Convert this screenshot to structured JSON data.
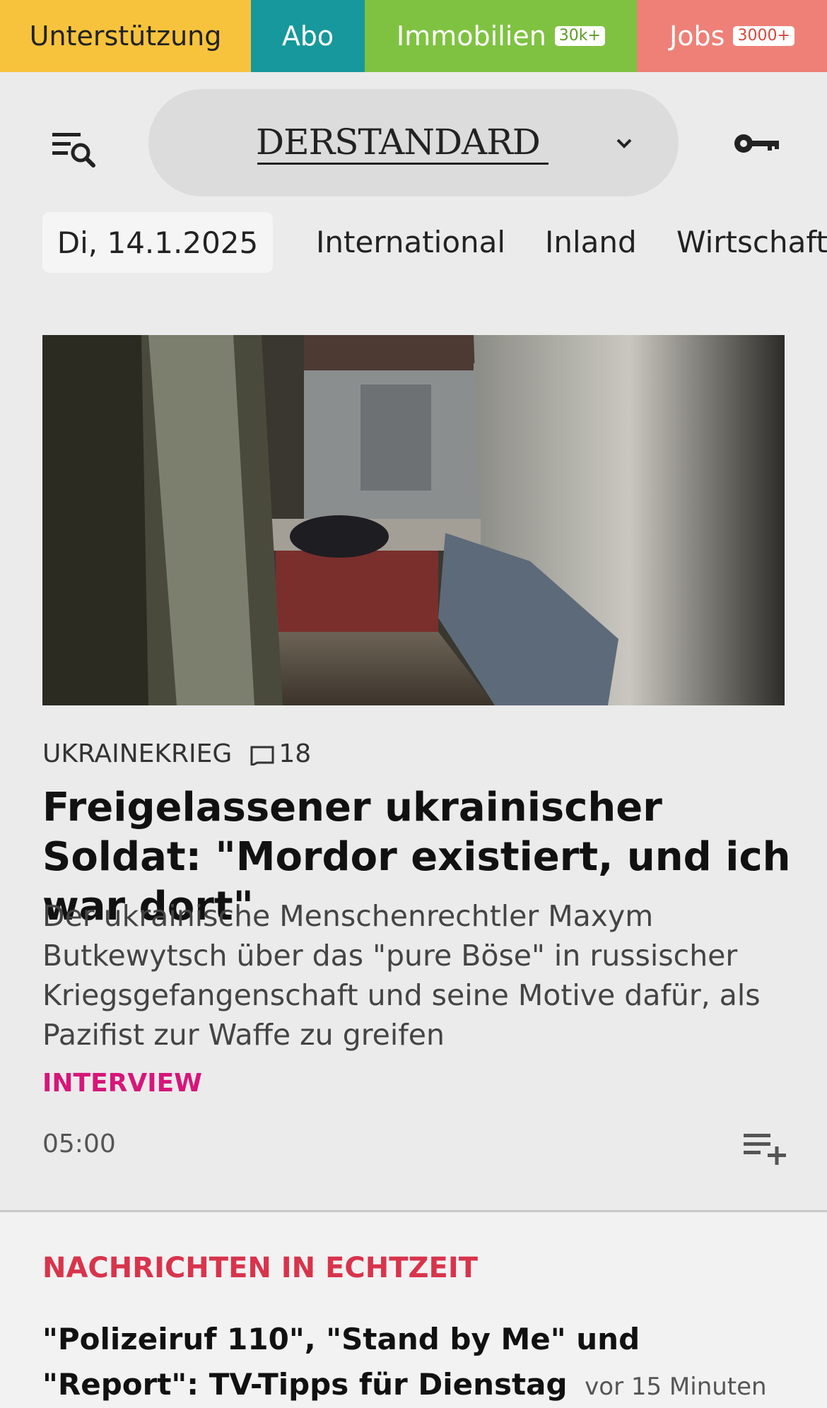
{
  "topbar": {
    "support_label": "Unterstützung",
    "abo_label": "Abo",
    "immobilien_label": "Immobilien",
    "immobilien_badge": "30k+",
    "jobs_label": "Jobs",
    "jobs_badge": "3000+"
  },
  "header": {
    "logo_text": "DERSTANDARD",
    "menu_icon": "menu-search-icon",
    "chevron_icon": "chevron-down-icon",
    "login_icon": "key-icon"
  },
  "nav": {
    "date": "Di, 14.1.2025",
    "items": [
      "International",
      "Inland",
      "Wirtschaft"
    ]
  },
  "article": {
    "category": "UKRAINEKRIEG",
    "comments": "18",
    "headline": "Freigelassener ukrainischer Soldat: \"Mordor existiert, und ich war dort\"",
    "teaser": "Der ukrainische Menschenrechtler Maxym Butkewytsch über das \"pure Böse\" in russischer Kriegsgefangenschaft und seine Motive dafür, als Pazifist zur Waffe zu greifen",
    "tag": "INTERVIEW",
    "time": "05:00"
  },
  "live": {
    "section_title": "NACHRICHTEN IN ECHTZEIT",
    "news_title": "\"Polizeiruf 110\", \"Stand by Me\" und \"Report\": TV-Tipps für Dienstag",
    "news_time": "vor 15 Minuten"
  },
  "colors": {
    "support": "#f7c33c",
    "abo": "#16989c",
    "immobilien": "#7fc241",
    "jobs": "#ee8077",
    "tag": "#d6167a",
    "section_title": "#d8344c"
  }
}
